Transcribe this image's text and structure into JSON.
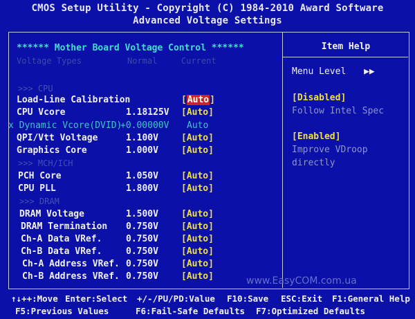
{
  "header": {
    "line1": "CMOS Setup Utility - Copyright (C) 1984-2010 Award Software",
    "line2": "Advanced Voltage Settings"
  },
  "main": {
    "section_title": "****** Mother Board Voltage Control ******",
    "columns": {
      "type": "Voltage Types",
      "normal": "Normal",
      "current": "Current"
    },
    "groups": {
      "cpu": ">>> CPU",
      "mch": ">>> MCH/ICH",
      "dram": ">>> DRAM"
    },
    "rows": [
      {
        "label": "Load-Line Calibration",
        "normal": "",
        "current": "[Auto]",
        "selected": true
      },
      {
        "label": "CPU Vcore",
        "normal": "1.18125V",
        "current": "[Auto]"
      },
      {
        "label": "x Dynamic Vcore(DVID)",
        "normal": "+0.00000V",
        "current": "Auto",
        "disabled": true
      },
      {
        "label": "QPI/Vtt Voltage",
        "normal": "1.100V",
        "current": "[Auto]"
      },
      {
        "label": "Graphics Core",
        "normal": "1.000V",
        "current": "[Auto]"
      },
      {
        "label": "PCH Core",
        "normal": "1.050V",
        "current": "[Auto]"
      },
      {
        "label": "CPU PLL",
        "normal": "1.800V",
        "current": "[Auto]"
      },
      {
        "label": "DRAM Voltage",
        "normal": "1.500V",
        "current": "[Auto]"
      },
      {
        "label": "DRAM Termination",
        "normal": "0.750V",
        "current": "[Auto]"
      },
      {
        "label": "Ch-A Data VRef.",
        "normal": "0.750V",
        "current": "[Auto]"
      },
      {
        "label": "Ch-B Data VRef.",
        "normal": "0.750V",
        "current": "[Auto]"
      },
      {
        "label": "Ch-A Address VRef.",
        "normal": "0.750V",
        "current": "[Auto]"
      },
      {
        "label": "Ch-B Address VRef.",
        "normal": "0.750V",
        "current": "[Auto]"
      }
    ]
  },
  "help": {
    "title": "Item Help",
    "menu_level_label": "Menu Level",
    "menu_level_arrow": "▶▶",
    "opt1_name": "[Disabled]",
    "opt1_desc": "Follow Intel Spec",
    "opt2_name": "[Enabled]",
    "opt2_desc_1": "Improve VDroop",
    "opt2_desc_2": "directly"
  },
  "watermark": "www.EasyCOM.com.ua",
  "footer": {
    "move": "↑↓++:Move",
    "select": "Enter:Select",
    "value": "+/-/PU/PD:Value",
    "save": "F10:Save",
    "exit": "ESC:Exit",
    "general_help": "F1:General Help",
    "previous": "F5:Previous Values",
    "failsafe": "F6:Fail-Safe Defaults",
    "optimized": "F7:Optimized Defaults"
  },
  "colors": {
    "background": "#0a10a8",
    "text": "#f2f2f6",
    "option": "#f0e040",
    "section": "#3ee0c8",
    "highlight": "#c8242c"
  }
}
